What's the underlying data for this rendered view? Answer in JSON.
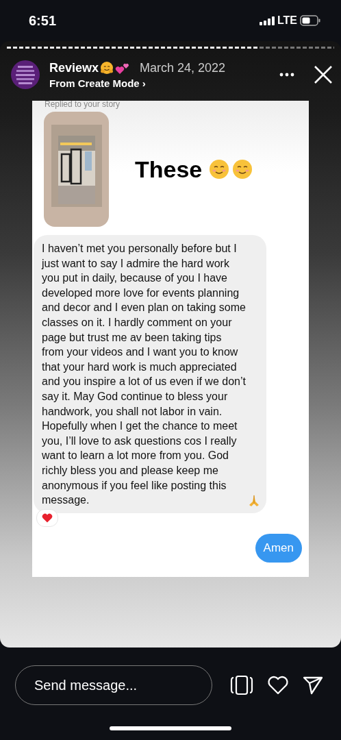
{
  "status_bar": {
    "time": "6:51",
    "network": "LTE"
  },
  "story_progress": {
    "level": 0.77
  },
  "header": {
    "username": "Reviewx",
    "date": "March 24, 2022",
    "subtitle": "From Create Mode ›"
  },
  "conversation": {
    "context": "Replied to your story",
    "story_reply": "These",
    "message": "I haven’t met you personally before but I just want to say I admire the hard work you put in daily, because of you I have developed more love for events planning and decor and I even plan on taking some classes on it. I hardly comment on your page but trust me av been taking tips from your videos and I want you to know that your hard work is much appreciated and you inspire a lot of us even if we don’t say it. May God continue to bless your handwork, you shall not labor in vain. Hopefully when I get the chance to meet you, I’ll love to ask questions cos I really want to learn a lot more from you. God richly bless you and please keep me anonymous if you feel like posting this message.",
    "reply": "Amen"
  },
  "footer": {
    "placeholder": "Send message..."
  }
}
